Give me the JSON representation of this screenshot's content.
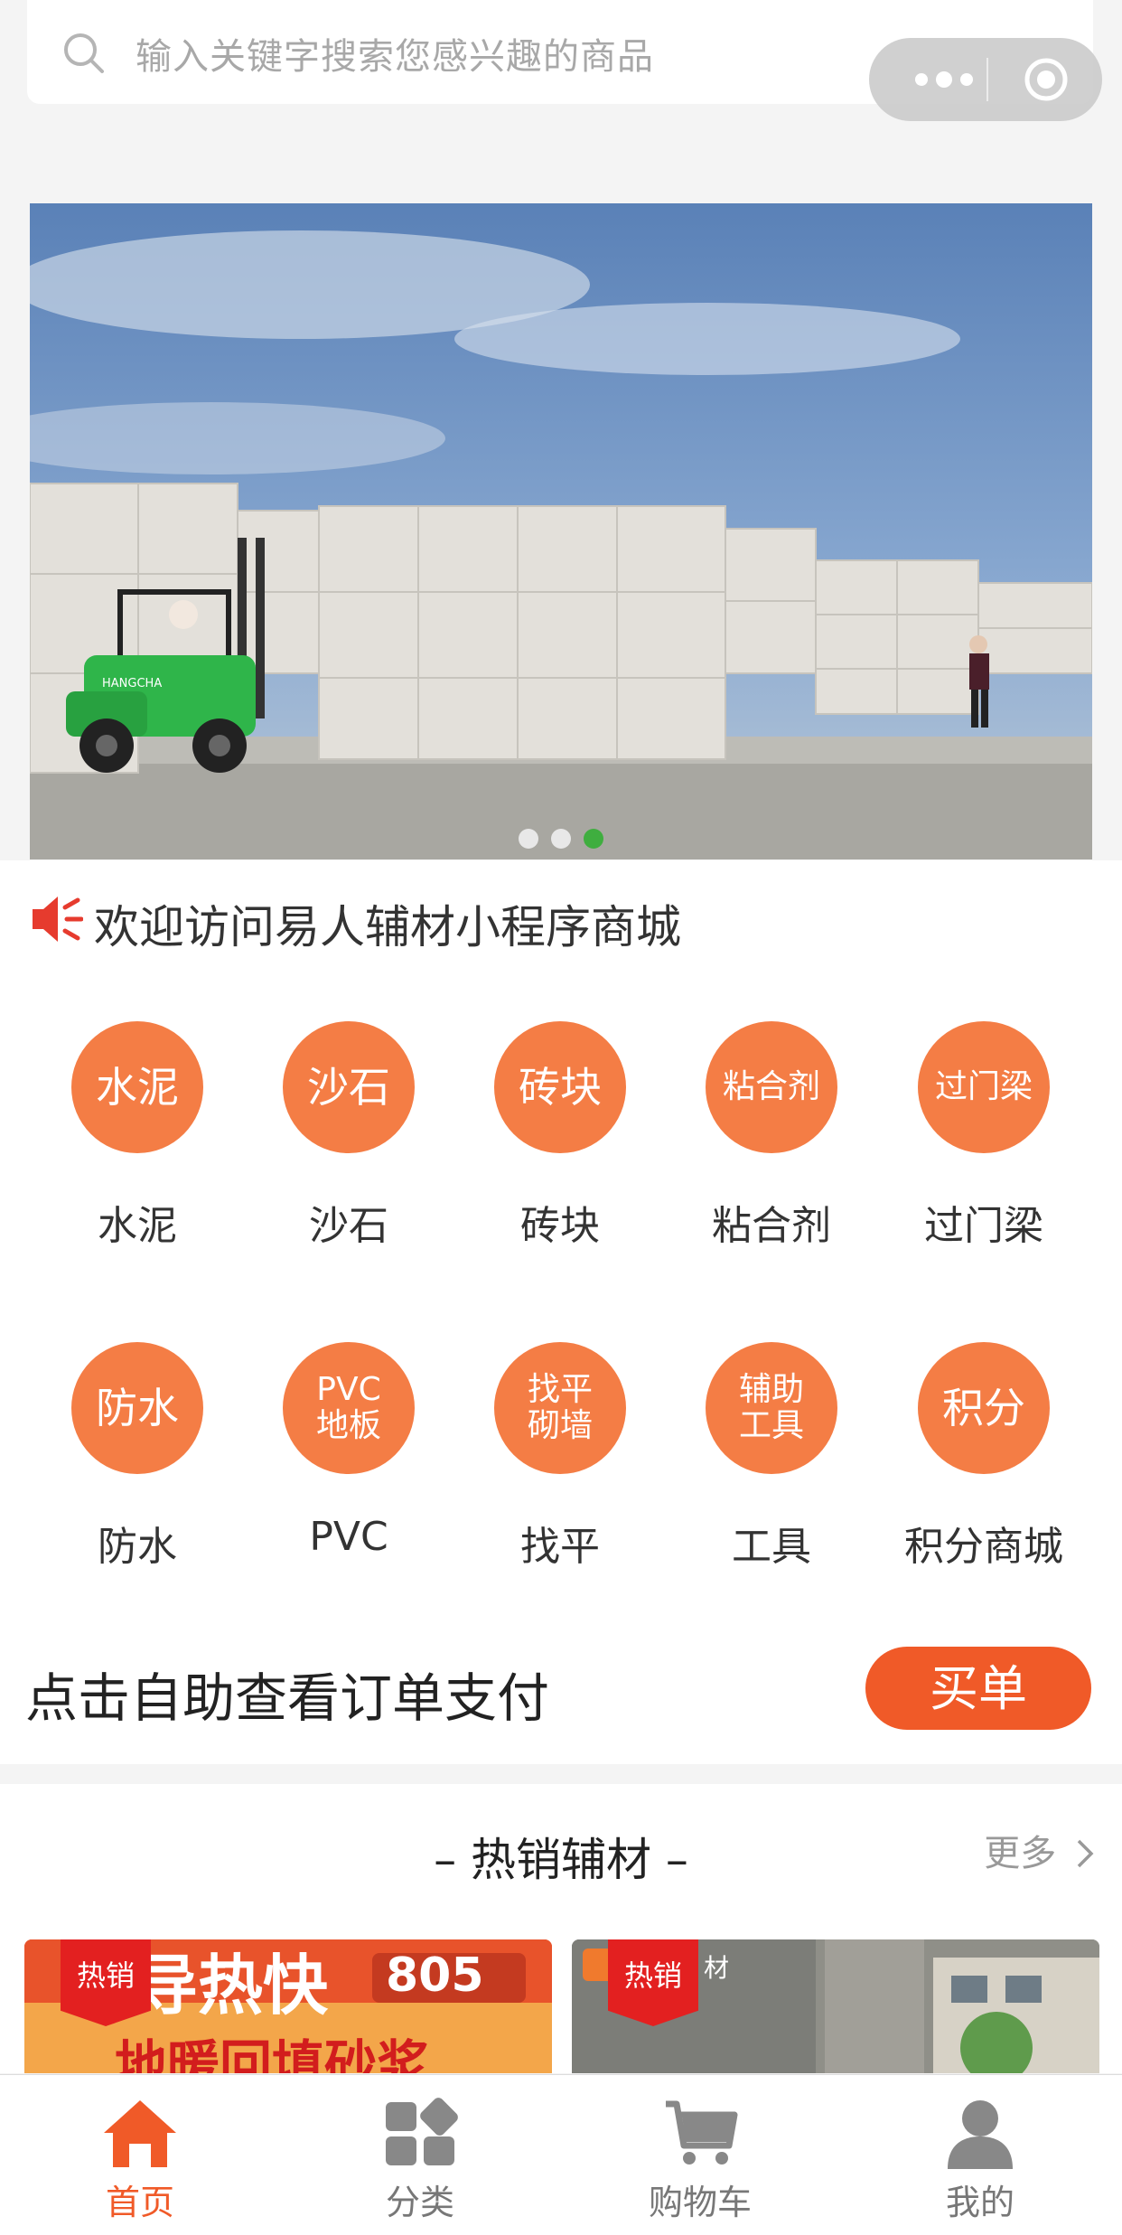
{
  "search": {
    "placeholder": "输入关键字搜索您感兴趣的商品"
  },
  "banner": {
    "slides": 3,
    "active_slide": 3,
    "forklift_brand": "HANGCHA"
  },
  "notice": {
    "text": "欢迎访问易人辅材小程序商城"
  },
  "categories": [
    {
      "icon_text": [
        "水泥"
      ],
      "label": "水泥"
    },
    {
      "icon_text": [
        "沙石"
      ],
      "label": "沙石"
    },
    {
      "icon_text": [
        "砖块"
      ],
      "label": "砖块"
    },
    {
      "icon_text": [
        "粘合剂"
      ],
      "label": "粘合剂"
    },
    {
      "icon_text": [
        "过门梁"
      ],
      "label": "过门梁"
    },
    {
      "icon_text": [
        "防水"
      ],
      "label": "防水"
    },
    {
      "icon_text": [
        "PVC",
        "地板"
      ],
      "label": "PVC"
    },
    {
      "icon_text": [
        "找平",
        "砌墙"
      ],
      "label": "找平"
    },
    {
      "icon_text": [
        "辅助",
        "工具"
      ],
      "label": "工具"
    },
    {
      "icon_text": [
        "积分"
      ],
      "label": "积分商城"
    }
  ],
  "pay": {
    "text": "点击自助查看订单支付",
    "button": "买单"
  },
  "hot": {
    "title": "– 热销辅材 –",
    "more": "更多",
    "cards": [
      {
        "tag": "热销",
        "line1": "导热快",
        "badge": "805",
        "line2": "地暖回填砂浆"
      },
      {
        "tag": "热销",
        "brand_text": "材"
      }
    ]
  },
  "tabs": [
    {
      "label": "首页",
      "icon": "home-icon",
      "active": true
    },
    {
      "label": "分类",
      "icon": "category-icon",
      "active": false
    },
    {
      "label": "购物车",
      "icon": "cart-icon",
      "active": false
    },
    {
      "label": "我的",
      "icon": "user-icon",
      "active": false
    }
  ],
  "colors": {
    "accent": "#f05a28",
    "category": "#f47d45",
    "hot_tag": "#e32020",
    "dot_active": "#3fae3f"
  }
}
